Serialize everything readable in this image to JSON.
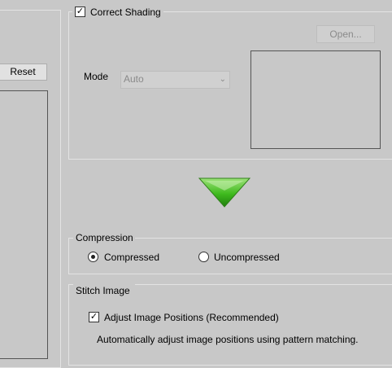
{
  "left_panel": {
    "reset_label": "Reset"
  },
  "shading": {
    "checkbox_label": "Correct Shading",
    "checked": true,
    "open_label": "Open...",
    "mode_label": "Mode",
    "mode_value": "Auto"
  },
  "compression": {
    "title": "Compression",
    "options": [
      {
        "label": "Compressed",
        "selected": true
      },
      {
        "label": "Uncompressed",
        "selected": false
      }
    ]
  },
  "stitch": {
    "title": "Stitch Image",
    "adjust_label": "Adjust Image Positions (Recommended)",
    "adjust_checked": true,
    "description": "Automatically adjust image positions using pattern matching."
  },
  "icons": {
    "check": "checkmark-icon",
    "arrow": "green-down-arrow-icon"
  },
  "colors": {
    "arrow_green": "#3fba1e",
    "background": "#c8c8c8"
  }
}
